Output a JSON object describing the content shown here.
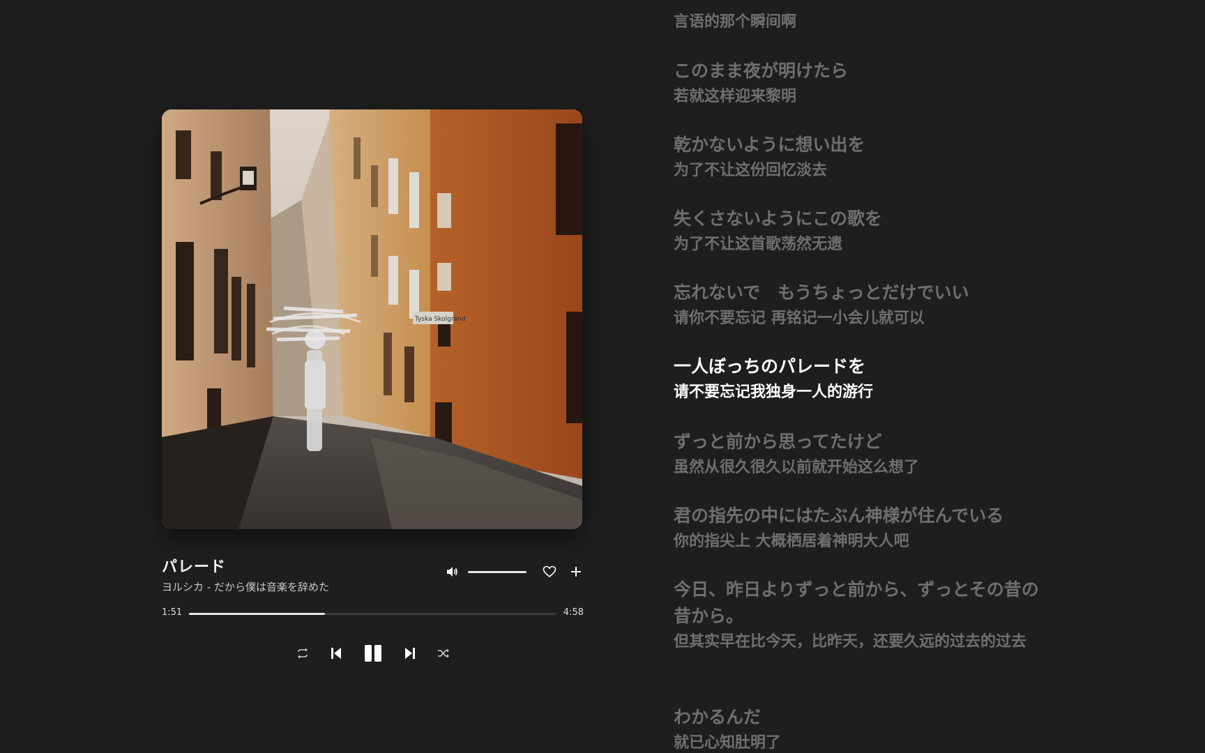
{
  "song": {
    "title": "パレード",
    "subtitle": "ヨルシカ - だから僕は音楽を辞めた"
  },
  "playback": {
    "current_time": "1:51",
    "total_time": "4:58",
    "progress": 0.37,
    "volume": 1.0,
    "state": "playing"
  },
  "icons": {
    "volume": "speaker-icon",
    "like": "heart-icon",
    "add": "plus-icon",
    "repeat": "repeat-icon",
    "previous": "skip-previous-icon",
    "pause": "pause-icon",
    "next": "skip-next-icon",
    "shuffle": "shuffle-icon"
  },
  "colors": {
    "background": "#1e1e1e",
    "lyric_inactive": "#6f6f6f",
    "lyric_active": "#ffffff"
  },
  "lyrics": [
    {
      "jp": "",
      "cn": "言语的那个瞬间啊"
    },
    {
      "jp": "このまま夜が明けたら",
      "cn": "若就这样迎来黎明"
    },
    {
      "jp": "乾かないように想い出を",
      "cn": "为了不让这份回忆淡去"
    },
    {
      "jp": "失くさないようにこの歌を",
      "cn": "为了不让这首歌荡然无遗"
    },
    {
      "jp": "忘れないで　もうちょっとだけでいい",
      "cn": "请你不要忘记 再铭记一小会儿就可以"
    },
    {
      "jp": "一人ぼっちのパレードを",
      "cn": "请不要忘记我独身一人的游行",
      "active": true
    },
    {
      "jp": "ずっと前から思ってたけど",
      "cn": "虽然从很久很久以前就开始这么想了"
    },
    {
      "jp": "君の指先の中にはたぶん神様が住んでいる",
      "cn": "你的指尖上 大概栖居着神明大人吧"
    },
    {
      "jp": "今日、昨日よりずっと前から、ずっとその昔の昔から。",
      "cn": "但其实早在比今天，比昨天，还要久远的过去的过去"
    },
    {
      "jp": "わかるんだ",
      "cn": "就已心知肚明了"
    }
  ]
}
